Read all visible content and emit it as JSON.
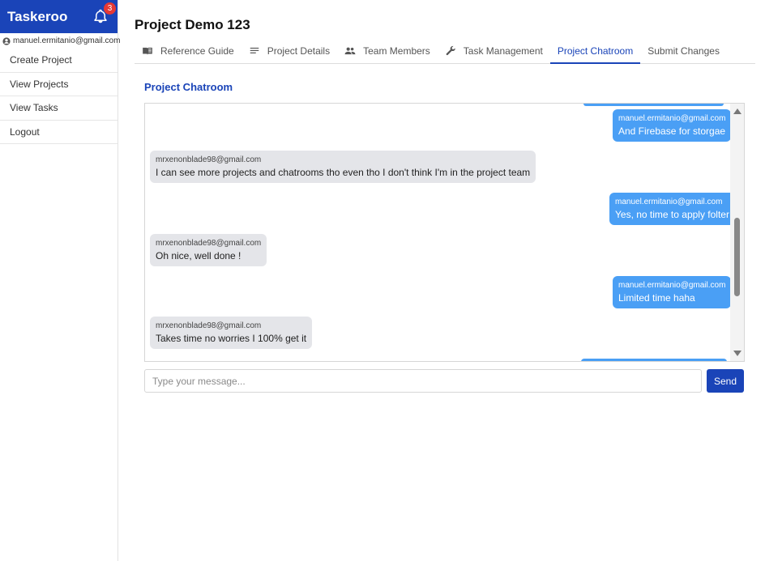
{
  "app": {
    "name": "Taskeroo",
    "notification_count": "3",
    "user_email": "manuel.ermitanio@gmail.com"
  },
  "sidebar": {
    "items": [
      {
        "label": "Create Project"
      },
      {
        "label": "View Projects"
      },
      {
        "label": "View Tasks"
      },
      {
        "label": "Logout"
      }
    ]
  },
  "header": {
    "title": "Project Demo 123"
  },
  "tabs": [
    {
      "label": "Reference Guide",
      "icon": "book-icon"
    },
    {
      "label": "Project Details",
      "icon": "lines-icon"
    },
    {
      "label": "Team Members",
      "icon": "people-icon"
    },
    {
      "label": "Task Management",
      "icon": "wrench-icon"
    },
    {
      "label": "Project Chatroom",
      "active": true
    },
    {
      "label": "Submit Changes"
    }
  ],
  "chat": {
    "title": "Project Chatroom",
    "messages": [
      {
        "from": "manuel.ermitanio@gmail.com",
        "text": "And Firebase for storgae",
        "mine": true
      },
      {
        "from": "mrxenonblade98@gmail.com",
        "text": "I can see more projects and chatrooms tho even tho I don't think I'm in the project team",
        "mine": false
      },
      {
        "from": "manuel.ermitanio@gmail.com",
        "text": "Yes, no time to apply folter",
        "mine": true
      },
      {
        "from": "mrxenonblade98@gmail.com",
        "text": "Oh nice, well done !",
        "mine": false
      },
      {
        "from": "manuel.ermitanio@gmail.com",
        "text": "Limited time haha",
        "mine": true
      },
      {
        "from": "mrxenonblade98@gmail.com",
        "text": "Takes time no worries I 100% get it",
        "mine": false
      }
    ],
    "input_placeholder": "Type your message...",
    "input_value": "",
    "send_label": "Send"
  },
  "colors": {
    "brand": "#1a44b8",
    "my_bubble": "#4a9ff5",
    "their_bubble": "#e4e5e9",
    "badge": "#e53935"
  }
}
